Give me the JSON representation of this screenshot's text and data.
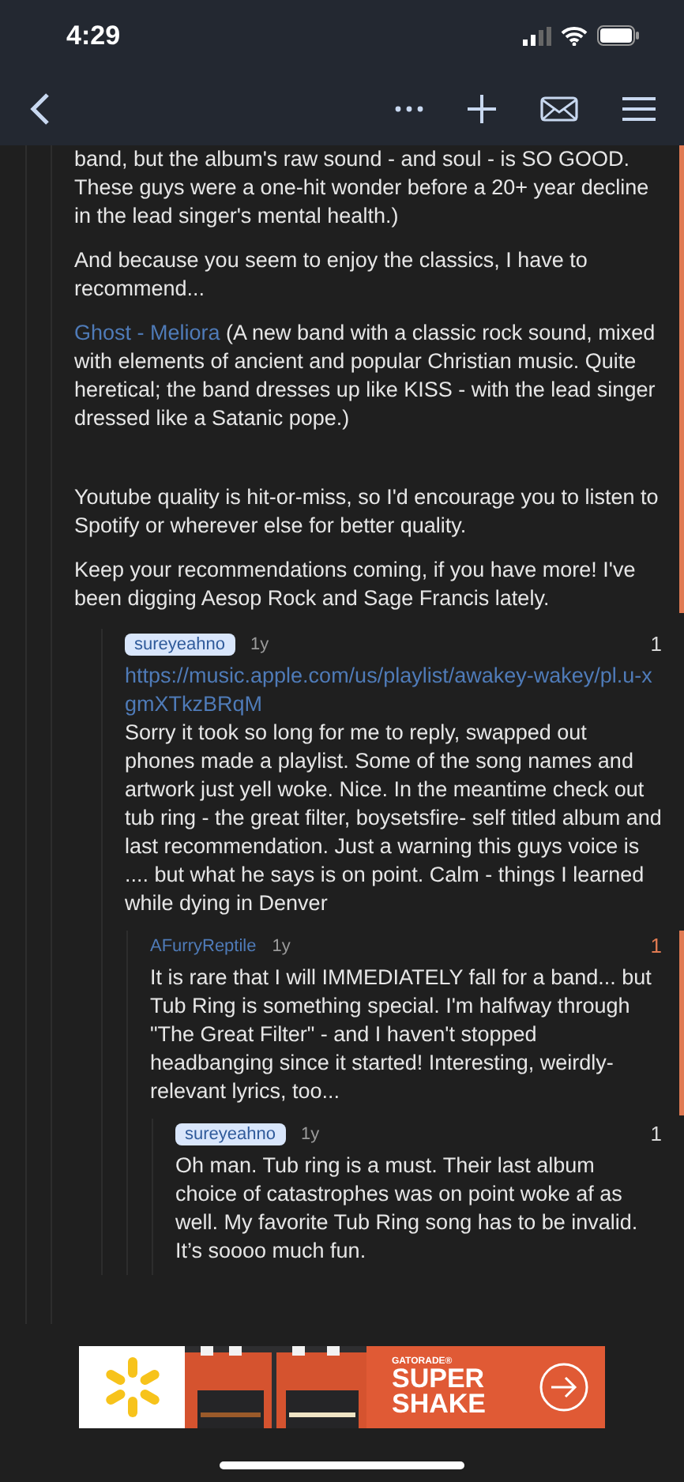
{
  "status_bar": {
    "time": "4:29"
  },
  "thread": {
    "new": true,
    "paragraphs": [
      {
        "kind": "text",
        "text": "band, but the album's raw sound - and soul - is SO GOOD. These guys were a one-hit wonder before a 20+ year decline in the lead singer's mental health.)"
      },
      {
        "kind": "text",
        "text": "And because you seem to enjoy the classics, I have to recommend..."
      },
      {
        "kind": "text",
        "link": "Ghost - Meliora",
        "text": " (A new band with a classic rock sound, mixed with elements of ancient and popular Christian music. Quite heretical; the band dresses up like KISS - with the lead singer dressed like a Satanic pope.)"
      },
      {
        "kind": "break"
      },
      {
        "kind": "text",
        "text": "Youtube quality is hit-or-miss, so I'd encourage you to listen to Spotify or wherever else for better quality."
      },
      {
        "kind": "text",
        "text": "Keep your recommendations coming, if you have more! I've been digging Aesop Rock and Sage Francis lately."
      }
    ],
    "replies": [
      {
        "author": "sureyeahno",
        "highlighted": true,
        "age": "1y",
        "score": "1",
        "upvoted": false,
        "new": false,
        "link": "https://music.apple.com/us/playlist/awakey-wakey/pl.u-xgmXTkzBRqM",
        "text": " Sorry it took so long for me to reply, swapped out phones made a playlist.  Some of the song names and artwork just yell woke.  Nice.  In the meantime check out tub ring - the great filter, boysetsfire- self titled album and last recommendation.  Just a warning this guys voice is ....  but what he says is on point.  Calm - things I learned while dying in Denver",
        "children": [
          {
            "author": "AFurryReptile",
            "highlighted": false,
            "age": "1y",
            "score": "1",
            "upvoted": true,
            "new": true,
            "text": "It is rare that I will IMMEDIATELY fall for a band... but Tub Ring is something special. I'm halfway through \"The Great Filter\" - and I haven't stopped headbanging since it started! Interesting, weirdly-relevant lyrics, too...",
            "children": [
              {
                "author": "sureyeahno",
                "highlighted": true,
                "age": "1y",
                "score": "1",
                "upvoted": false,
                "new": false,
                "text": "Oh man. Tub ring is a must.  Their last album choice of catastrophes was on point woke af as well.  My favorite Tub Ring song has to be invalid.  It’s soooo much fun."
              }
            ]
          }
        ]
      }
    ]
  },
  "ad": {
    "brand": "GATORADE®",
    "headline": [
      "SUPER",
      "SHAKE"
    ]
  }
}
